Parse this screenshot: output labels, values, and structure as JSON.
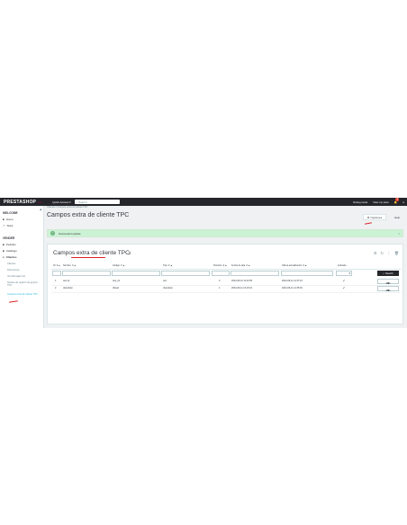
{
  "topbar": {
    "logo": "PRESTASHOP",
    "version": "1.7",
    "quick_access": "Quick Access ▾",
    "search_placeholder": "Search",
    "right_items": [
      "Debug mode",
      "View my store"
    ],
    "notifications_count": "1"
  },
  "sidebar": {
    "toggle": "◀",
    "sections": [
      {
        "label": "WELCOME",
        "items": [
          "Home",
          "Stats"
        ]
      },
      {
        "label": "VENDER",
        "items": [
          "Pedidos",
          "Catálogo",
          "Clientes"
        ]
      }
    ],
    "subitems": [
      "Clientes",
      "Direcciones",
      "Ver Mensajes Ver",
      "Niveles de registro de grupos TPC",
      "Campos extra de cliente TPC"
    ]
  },
  "breadcrumb": "Clientes  /  Campos extra de cliente TPC",
  "page_title": "Campos extra de cliente TPC",
  "toolbar": {
    "options_label": "Opciones",
    "help_label": "Help"
  },
  "alert": {
    "text": "Successful update",
    "close": "×"
  },
  "panel": {
    "title": "Campos extra de cliente TPC",
    "count": "2",
    "tools": [
      "⚙",
      "↻",
      "⋮",
      "🗑"
    ]
  },
  "table": {
    "headers": [
      "ID ▼▲",
      "Nombre ▼▲",
      "Código ▼▲",
      "Tipo ▼▲",
      "Posición ▼▲",
      "Fecha de alta ▼▲",
      "Última actualización ▼▲",
      "Activado"
    ],
    "search_label": "Search",
    "edit_label": "Edit",
    "rows": [
      {
        "id": "1",
        "name": "test ok",
        "code": "test_ok",
        "type": "text",
        "position": "0",
        "created": "2024-09-10 11:44:56",
        "updated": "2024-09-11 11:37:16",
        "active": "✔"
      },
      {
        "id": "2",
        "name": "dropdown",
        "code": "dhead",
        "type": "dropdown",
        "position": "1",
        "created": "2024-09-11 10:19:01",
        "updated": "2024-09-11 11:35:30",
        "active": "✔"
      }
    ]
  }
}
